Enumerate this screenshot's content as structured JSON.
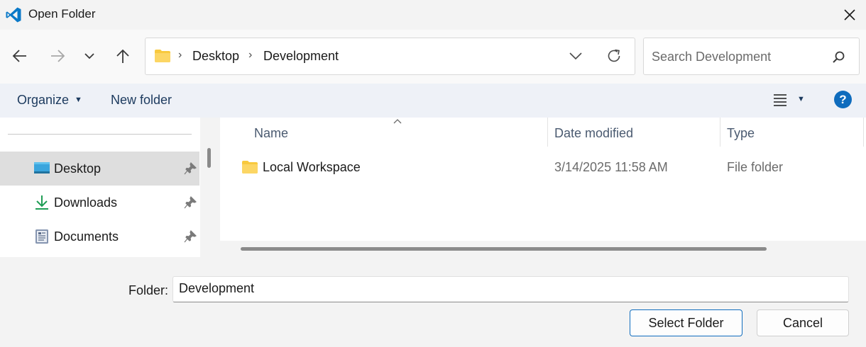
{
  "window": {
    "title": "Open Folder",
    "app_icon": "vscode-logo-icon",
    "close_icon": "close-icon"
  },
  "navigation": {
    "back_icon": "arrow-left-icon",
    "forward_icon": "arrow-right-icon",
    "recent_icon": "chevron-down-icon",
    "up_icon": "arrow-up-icon"
  },
  "address_bar": {
    "folder_icon": "folder-icon",
    "breadcrumbs": [
      "Desktop",
      "Development"
    ],
    "separator": "›",
    "dropdown_icon": "chevron-down-icon",
    "refresh_icon": "refresh-icon"
  },
  "search": {
    "placeholder": "Search Development",
    "icon": "search-icon"
  },
  "command_bar": {
    "organize": "Organize",
    "new_folder": "New folder",
    "view_icon": "list-view-icon",
    "help": "?"
  },
  "nav_pane": {
    "items": [
      {
        "label": "Desktop",
        "icon": "desktop-icon",
        "pinned": true,
        "selected": true
      },
      {
        "label": "Downloads",
        "icon": "download-icon",
        "pinned": true,
        "selected": false
      },
      {
        "label": "Documents",
        "icon": "documents-icon",
        "pinned": true,
        "selected": false
      }
    ]
  },
  "file_list": {
    "columns": [
      "Name",
      "Date modified",
      "Type"
    ],
    "sorted_by": "Name",
    "rows": [
      {
        "name": "Local Workspace",
        "date_modified": "3/14/2025 11:58 AM",
        "type": "File folder",
        "icon": "folder-icon"
      }
    ]
  },
  "footer": {
    "folder_label": "Folder:",
    "folder_value": "Development",
    "select_button": "Select Folder",
    "cancel_button": "Cancel"
  },
  "colors": {
    "accent": "#0f6cbd",
    "folder_yellow": "#f8c93e",
    "command_text": "#1c3a5e"
  }
}
